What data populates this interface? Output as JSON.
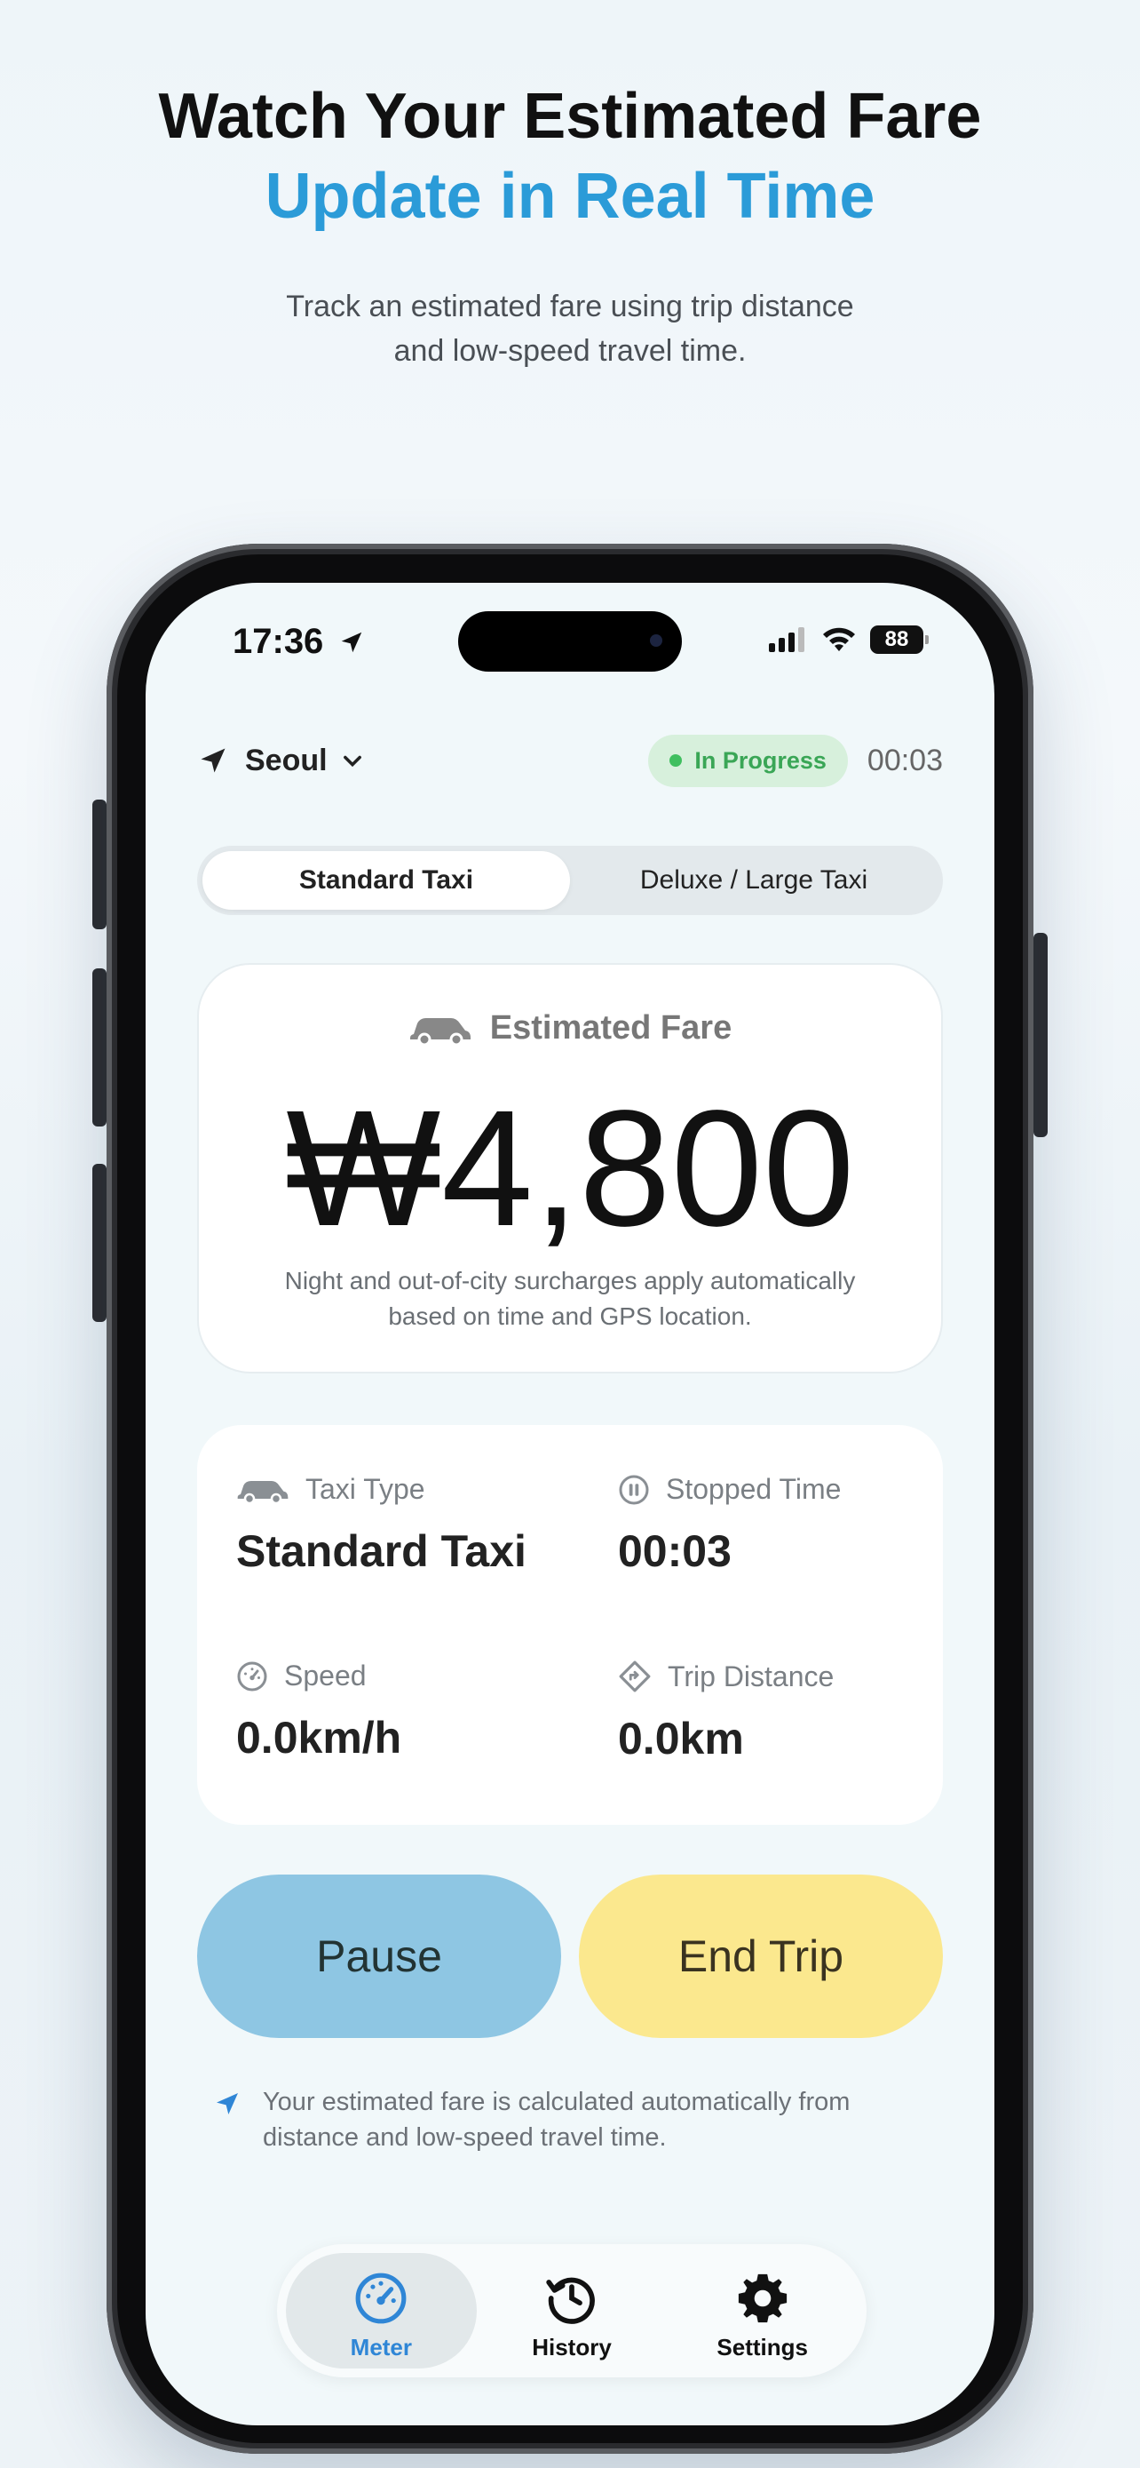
{
  "headline": {
    "line1": "Watch Your Estimated Fare",
    "line2": "Update in Real Time",
    "subtitle_line1": "Track an estimated fare using trip distance",
    "subtitle_line2": "and low-speed travel time."
  },
  "status_bar": {
    "time": "17:36",
    "battery": "88"
  },
  "topbar": {
    "city": "Seoul",
    "status_badge": "In Progress",
    "elapsed": "00:03"
  },
  "segment": {
    "options": [
      "Standard Taxi",
      "Deluxe / Large Taxi"
    ],
    "selected": "Standard Taxi"
  },
  "fare": {
    "label": "Estimated Fare",
    "value": "₩4,800",
    "note_line1": "Night and out-of-city surcharges apply automatically",
    "note_line2": "based on time and GPS location."
  },
  "info": {
    "taxi_type_label": "Taxi Type",
    "taxi_type_value": "Standard Taxi",
    "stopped_time_label": "Stopped Time",
    "stopped_time_value": "00:03",
    "speed_label": "Speed",
    "speed_value": "0.0km/h",
    "distance_label": "Trip Distance",
    "distance_value": "0.0km"
  },
  "actions": {
    "pause": "Pause",
    "end_trip": "End Trip"
  },
  "footnote": {
    "line1": "Your estimated fare is calculated automatically from",
    "line2": "distance and low-speed travel time."
  },
  "tabs": [
    {
      "label": "Meter",
      "icon": "speedometer-icon",
      "active": true
    },
    {
      "label": "History",
      "icon": "history-icon",
      "active": false
    },
    {
      "label": "Settings",
      "icon": "gear-icon",
      "active": false
    }
  ],
  "colors": {
    "accent": "#2b9bd8",
    "pause": "#8ec6e3",
    "end_trip": "#fbe88e",
    "in_progress": "#3fbf5f"
  }
}
